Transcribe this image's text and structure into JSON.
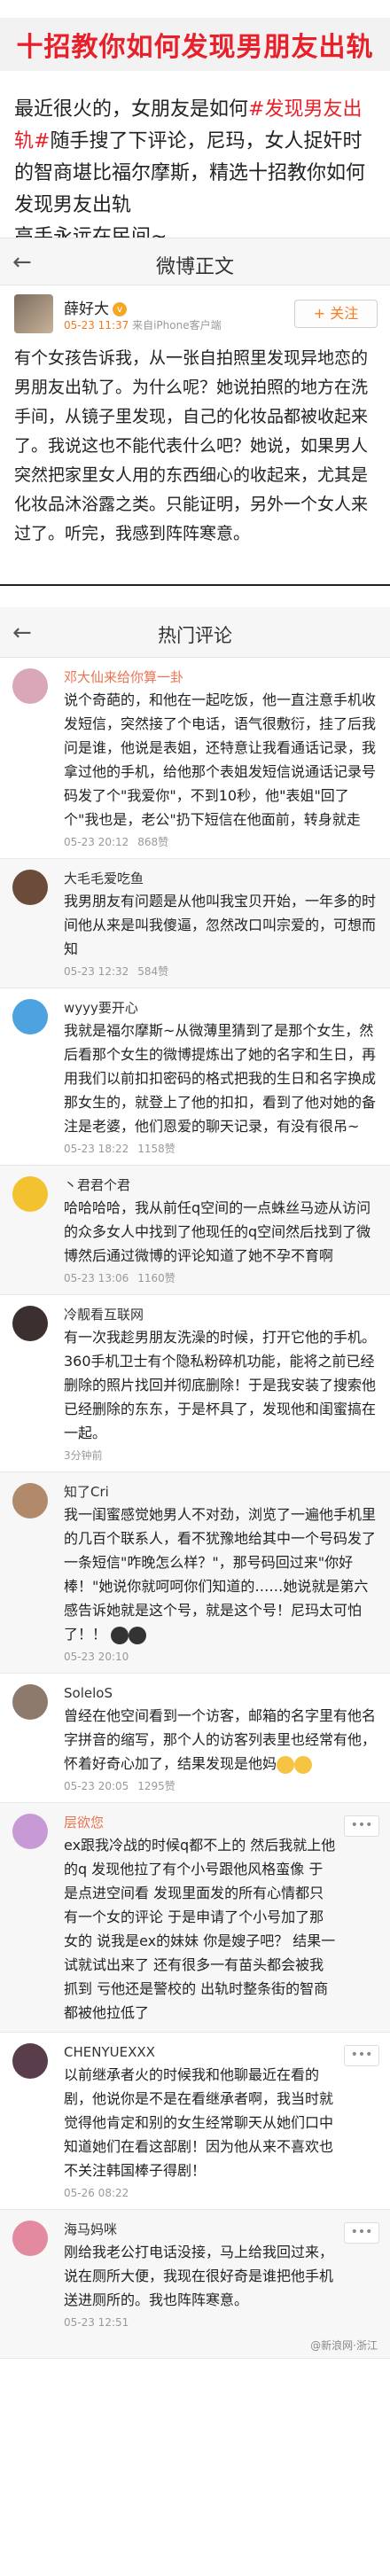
{
  "banner": {
    "title": "十招教你如何发现男朋友出轨"
  },
  "intro": {
    "p1": "最近很火的，女朋友是如何",
    "tag": "#发现男友出轨#",
    "p2": "随手搜了下评论，尼玛，女人捉奸时的智商堪比福尔摩斯，精选十招教你如何发现男友出轨",
    "p3": "高手永远在民间~"
  },
  "post_screen": {
    "title": "微博正文",
    "author": "薛好大",
    "time": "05-23 11:37",
    "source": "来自iPhone客户端",
    "follow_label": "+ 关注",
    "body": "有个女孩告诉我，从一张自拍照里发现异地恋的男朋友出轨了。为什么呢？她说拍照的地方在洗手间，从镜子里发现，自己的化妆品都被收起来了。我说这也不能代表什么吧？她说，如果男人突然把家里女人用的东西细心的收起来，尤其是化妆品沐浴露之类。只能证明，另外一个女人来过了。听完，我感到阵阵寒意。"
  },
  "comments_screen": {
    "title": "热门评论",
    "comments": [
      {
        "name": "邓大仙来给你算一卦",
        "text": "说个奇葩的，和他在一起吃饭，他一直注意手机收发短信，突然接了个电话，语气很敷衍，挂了后我问是谁，他说是表姐，还特意让我看通话记录，我拿过他的手机，给他那个表姐发短信说通话记录号码发了个\"我爱你\"，不到10秒，他\"表姐\"回了个\"我也是，老公\"扔下短信在他面前，转身就走",
        "time": "05-23 20:12",
        "likes": "868赞"
      },
      {
        "name": "大毛毛爱吃鱼",
        "text": "我男朋友有问题是从他叫我宝贝开始，一年多的时间他从来是叫我傻逼，忽然改口叫宗爱的，可想而知",
        "time": "05-23 12:32",
        "likes": "584赞"
      },
      {
        "name": "wyyy要开心",
        "text": "我就是福尔摩斯~从微薄里猜到了是那个女生，然后看那个女生的微博提炼出了她的名字和生日，再用我们以前扣扣密码的格式把我的生日和名字换成那女生的，就登上了他的扣扣，看到了他对她的备注是老婆，他们恩爱的聊天记录，有没有很吊~",
        "time": "05-23 18:22",
        "likes": "1158赞"
      },
      {
        "name": "丶君君个君",
        "text": "哈哈哈哈，我从前任q空间的一点蛛丝马迹从访问的众多女人中找到了他现任的q空间然后找到了微博然后通过微博的评论知道了她不孕不育啊",
        "time": "05-23 13:06",
        "likes": "1160赞"
      },
      {
        "name": "冷靓看互联网",
        "text": "有一次我趁男朋友洗澡的时候，打开它他的手机。360手机卫士有个隐私粉碎机功能，能将之前已经删除的照片找回并彻底删除！于是我安装了搜索他已经删除的东东，于是杯具了，发现他和闺蜜搞在一起。",
        "time": "3分钟前",
        "likes": ""
      },
      {
        "name": "知了Cri",
        "text": "我一闺蜜感觉她男人不对劲，浏览了一遍他手机里的几百个联系人，看不犹豫地给其中一个号码发了一条短信\"咋晚怎么样？\"，那号码回过来\"你好棒！\"她说你就呵呵你们知道的……她说就是第六感告诉她就是这个号，就是这个号！尼玛太可怕了！！",
        "time": "05-23 20:10",
        "likes": ""
      },
      {
        "name": "SoleloS",
        "text": "曾经在他空间看到一个访客，邮箱的名字里有他名字拼音的缩写，那个人的访客列表里也经常有他，怀着好奇心加了，结果发现是他妈",
        "time": "05-23 20:05",
        "likes": "1295赞"
      },
      {
        "name": "层欲您",
        "text": "ex跟我冷战的时候q都不上的 然后我就上他的q 发现他拉了有个小号跟他风格蛮像 于是点进空间看 发现里面发的所有心情都只有一个女的评论 于是申请了个小号加了那女的 说我是ex的妹妹 你是嫂子吧？ 结果一试就试出来了 还有很多一有苗头都会被我抓到 亏他还是警校的 出轨时整条街的智商都被他拉低了",
        "time": "",
        "likes": ""
      },
      {
        "name": "CHENYUEXXX",
        "text": "以前继承者火的时候我和他聊最近在看的剧，他说你是不是在看继承者啊，我当时就觉得他肯定和别的女生经常聊天从她们口中知道她们在看这部剧！因为他从来不喜欢也不关注韩国棒子得剧！",
        "time": "05-26 08:22",
        "likes": ""
      },
      {
        "name": "海马妈咪",
        "text": "刚给我老公打电话没接，马上给我回过来，说在厕所大便，我现在很好奇是谁把他手机送进厕所的。我也阵阵寒意。",
        "time": "05-23 12:51",
        "likes": ""
      }
    ],
    "more_label": "•••",
    "watermark": "@新浪网·浙江"
  },
  "colors": {
    "accent_red": "#e8202a",
    "weibo_orange": "#f07a1c"
  },
  "icons": {
    "back": "left-arrow-icon",
    "verified": "vip-badge-icon"
  }
}
